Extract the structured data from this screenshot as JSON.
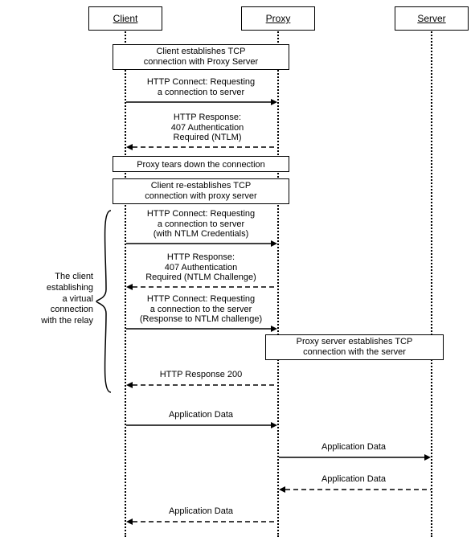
{
  "participants": {
    "client": "Client",
    "proxy": "Proxy",
    "server": "Server"
  },
  "blocks": {
    "b1": "Client establishes TCP\nconnection with Proxy Server",
    "b2": "Proxy tears down the connection",
    "b3": "Client re-establishes TCP\nconnection with proxy server",
    "b4": "Proxy server establishes TCP\nconnection with the server"
  },
  "messages": {
    "m1": "HTTP Connect: Requesting\na connection to server",
    "m2": "HTTP Response:\n407 Authentication\nRequired (NTLM)",
    "m3": "HTTP Connect: Requesting\na connection to server\n(with NTLM Credentials)",
    "m4": "HTTP Response:\n407 Authentication\nRequired (NTLM Challenge)",
    "m5": "HTTP Connect: Requesting\na connection to the server\n(Response to NTLM challenge)",
    "m6": "HTTP Response 200",
    "m7": "Application Data",
    "m8": "Application Data",
    "m9": "Application Data",
    "m10": "Application Data"
  },
  "note": "The client\nestablishing\na virtual\nconnection\nwith the relay",
  "chart_data": {
    "type": "sequence-diagram",
    "participants": [
      "Client",
      "Proxy",
      "Server"
    ],
    "steps": [
      {
        "kind": "block",
        "span": [
          "Client",
          "Proxy"
        ],
        "text": "Client establishes TCP connection with Proxy Server"
      },
      {
        "kind": "message",
        "from": "Client",
        "to": "Proxy",
        "style": "solid",
        "text": "HTTP Connect: Requesting a connection to server"
      },
      {
        "kind": "message",
        "from": "Proxy",
        "to": "Client",
        "style": "dashed",
        "text": "HTTP Response: 407 Authentication Required (NTLM)"
      },
      {
        "kind": "block",
        "span": [
          "Client",
          "Proxy"
        ],
        "text": "Proxy tears down the connection"
      },
      {
        "kind": "block",
        "span": [
          "Client",
          "Proxy"
        ],
        "text": "Client re-establishes TCP connection with proxy server"
      },
      {
        "kind": "message",
        "from": "Client",
        "to": "Proxy",
        "style": "solid",
        "text": "HTTP Connect: Requesting a connection to server (with NTLM Credentials)"
      },
      {
        "kind": "message",
        "from": "Proxy",
        "to": "Client",
        "style": "dashed",
        "text": "HTTP Response: 407 Authentication Required (NTLM Challenge)"
      },
      {
        "kind": "message",
        "from": "Client",
        "to": "Proxy",
        "style": "solid",
        "text": "HTTP Connect: Requesting a connection to the server (Response to NTLM challenge)"
      },
      {
        "kind": "block",
        "span": [
          "Proxy",
          "Server"
        ],
        "text": "Proxy server establishes TCP connection with the server"
      },
      {
        "kind": "message",
        "from": "Proxy",
        "to": "Client",
        "style": "dashed",
        "text": "HTTP Response 200"
      },
      {
        "kind": "message",
        "from": "Client",
        "to": "Proxy",
        "style": "solid",
        "text": "Application Data"
      },
      {
        "kind": "message",
        "from": "Proxy",
        "to": "Server",
        "style": "solid",
        "text": "Application Data"
      },
      {
        "kind": "message",
        "from": "Server",
        "to": "Proxy",
        "style": "dashed",
        "text": "Application Data"
      },
      {
        "kind": "message",
        "from": "Proxy",
        "to": "Client",
        "style": "dashed",
        "text": "Application Data"
      }
    ],
    "annotations": [
      {
        "text": "The client establishing a virtual connection with the relay",
        "attached_to_steps": [
          6,
          7,
          8,
          9,
          10
        ]
      }
    ]
  }
}
